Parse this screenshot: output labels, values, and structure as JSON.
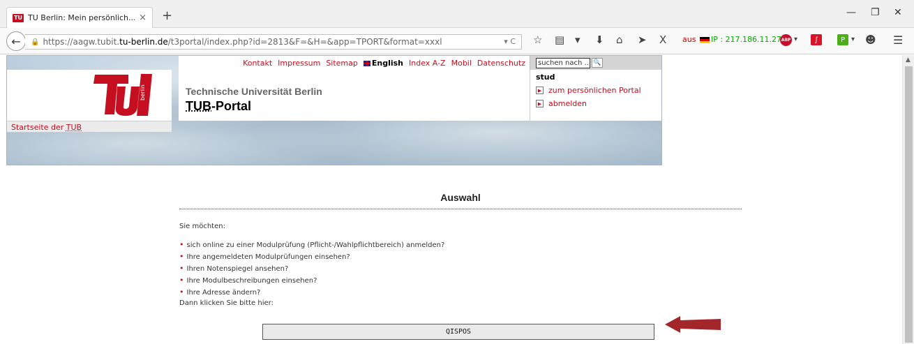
{
  "browser": {
    "tab_title": "TU Berlin: Mein persönlich...",
    "tab_close": "×",
    "new_tab": "+",
    "url_prefix": "https://aagw.tubit.",
    "url_domain": "tu-berlin.de",
    "url_suffix": "/t3portal/index.php?id=2813&F=&H=&app=TPORT&format=xxxl",
    "addon_aus": "aus",
    "addon_ip": "IP : 217.186.11.27",
    "icons": [
      "back-icon",
      "lock-icon",
      "reload-icon",
      "star-icon",
      "reading-list-icon",
      "pocket-icon",
      "download-icon",
      "home-icon",
      "send-icon",
      "x-icon",
      "abp-icon",
      "menu-icon"
    ]
  },
  "header": {
    "top_menu": [
      "Kontakt",
      "Impressum",
      "Sitemap",
      "English",
      "Index A-Z",
      "Mobil",
      "Datenschutz"
    ],
    "search_placeholder": "suchen nach ...",
    "university": "Technische Universität Berlin",
    "portal_prefix": "TUB",
    "portal_suffix": "-Portal",
    "startseite_prefix": "Startseite der ",
    "startseite_tub": "TUB",
    "user": "stud",
    "user_links": [
      "zum persönlichen Portal",
      "abmelden"
    ]
  },
  "main": {
    "heading": "Auswahl",
    "intro": "Sie möchten:",
    "options": [
      "sich online zu einer Modulprüfung (Pflicht-/Wahlpflichtbereich) anmelden?",
      "Ihre angemeldeten Modulprüfungen einsehen?",
      "Ihren Notenspiegel ansehen?",
      "Ihre Modulbeschreibungen einsehen?",
      "Ihre Adresse ändern?"
    ],
    "outro": "Dann klicken Sie bitte hier:",
    "button": "QISPOS"
  },
  "colors": {
    "accent": "#c50e1f",
    "header_bg": "#a9bfd0"
  }
}
